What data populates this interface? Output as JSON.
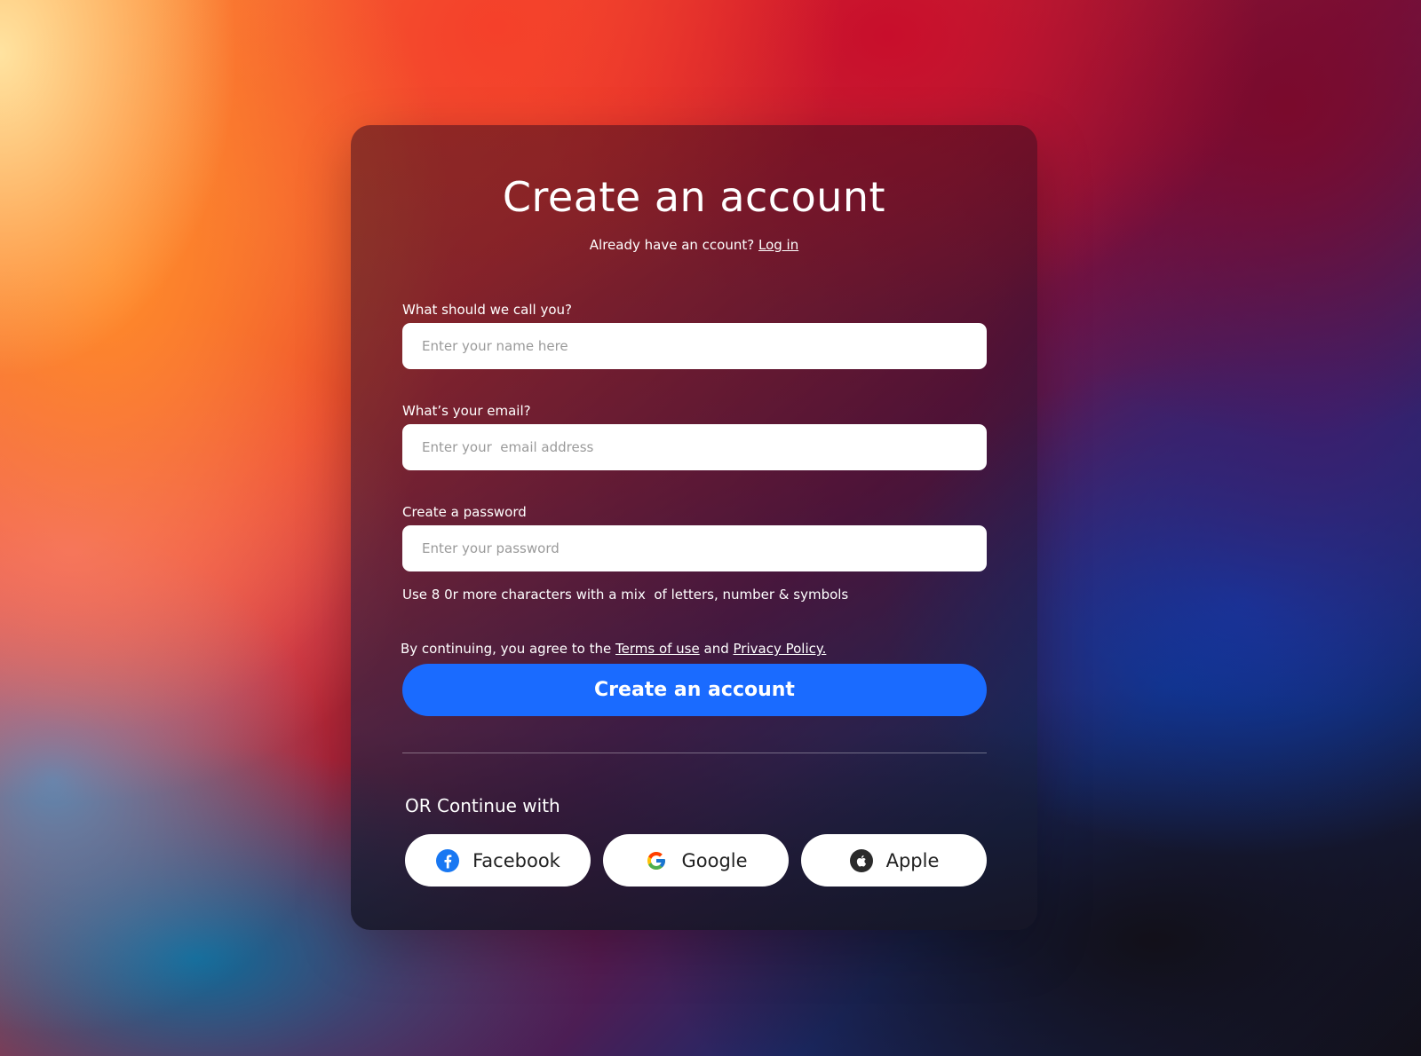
{
  "form": {
    "title": "Create an account",
    "login_prompt": "Already have an ccount?",
    "login_link": "Log in",
    "name_label": "What should we call you?",
    "name_placeholder": "Enter your name here",
    "email_label": "What’s your email?",
    "email_placeholder": "Enter your  email address",
    "password_label": "Create a password",
    "password_placeholder": "Enter your password",
    "password_hint": "Use 8 0r more characters with a mix  of letters, number & symbols",
    "terms_prefix": "By continuing, you agree to the",
    "terms_link": "Terms of use",
    "terms_and": "and",
    "privacy_link": "Privacy Policy.",
    "submit_label": "Create an account"
  },
  "social": {
    "heading": "OR Continue with",
    "buttons": [
      {
        "label": "Facebook",
        "icon": "facebook-icon"
      },
      {
        "label": "Google",
        "icon": "google-icon"
      },
      {
        "label": "Apple",
        "icon": "apple-icon"
      }
    ]
  },
  "colors": {
    "primary": "#1a6bff",
    "facebook": "#1877f2",
    "apple": "#2b2b2b"
  }
}
